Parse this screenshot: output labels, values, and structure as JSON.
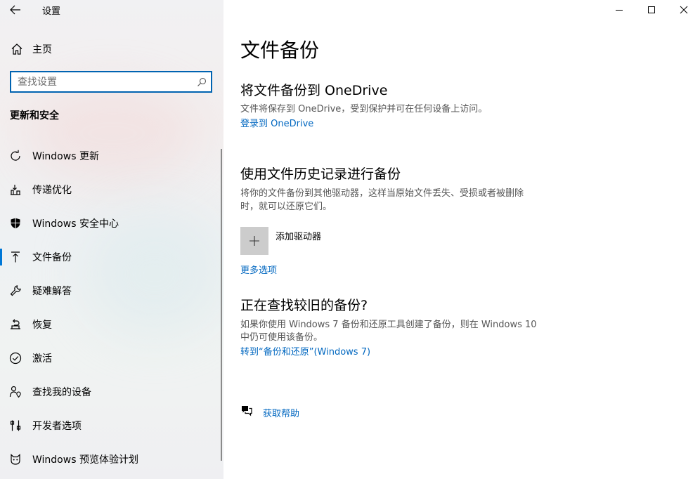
{
  "app": {
    "title": "设置"
  },
  "sidebar": {
    "home_label": "主页",
    "search_placeholder": "查找设置",
    "section_title": "更新和安全",
    "items": [
      {
        "label": "Windows 更新",
        "icon": "refresh-icon"
      },
      {
        "label": "传递优化",
        "icon": "delivery-optimization-icon"
      },
      {
        "label": "Windows 安全中心",
        "icon": "shield-icon"
      },
      {
        "label": "文件备份",
        "icon": "backup-arrow-icon",
        "active": true
      },
      {
        "label": "疑难解答",
        "icon": "wrench-icon"
      },
      {
        "label": "恢复",
        "icon": "recovery-icon"
      },
      {
        "label": "激活",
        "icon": "check-circle-icon"
      },
      {
        "label": "查找我的设备",
        "icon": "person-location-icon"
      },
      {
        "label": "开发者选项",
        "icon": "developer-tools-icon"
      },
      {
        "label": "Windows 预览体验计划",
        "icon": "insider-cat-icon"
      }
    ]
  },
  "main": {
    "title": "文件备份",
    "onedrive": {
      "heading": "将文件备份到 OneDrive",
      "desc": "文件将保存到 OneDrive，受到保护并可在任何设备上访问。",
      "link": "登录到 OneDrive"
    },
    "file_history": {
      "heading": "使用文件历史记录进行备份",
      "desc_line1": "将你的文件备份到其他驱动器，这样当原始文件丢失、受损或者被删除",
      "desc_line2": "时，就可以还原它们。",
      "add_drive_label": "添加驱动器",
      "more_options": "更多选项"
    },
    "older_backup": {
      "heading": "正在查找较旧的备份?",
      "desc_line1": "如果你使用 Windows 7 备份和还原工具创建了备份，则在 Windows 10",
      "desc_line2": "中仍可使用该备份。",
      "link": "转到“备份和还原”(Windows 7)"
    },
    "help_label": "获取帮助"
  },
  "colors": {
    "accent": "#0078d7",
    "link": "#0067c0",
    "search_border": "#0063b1"
  }
}
